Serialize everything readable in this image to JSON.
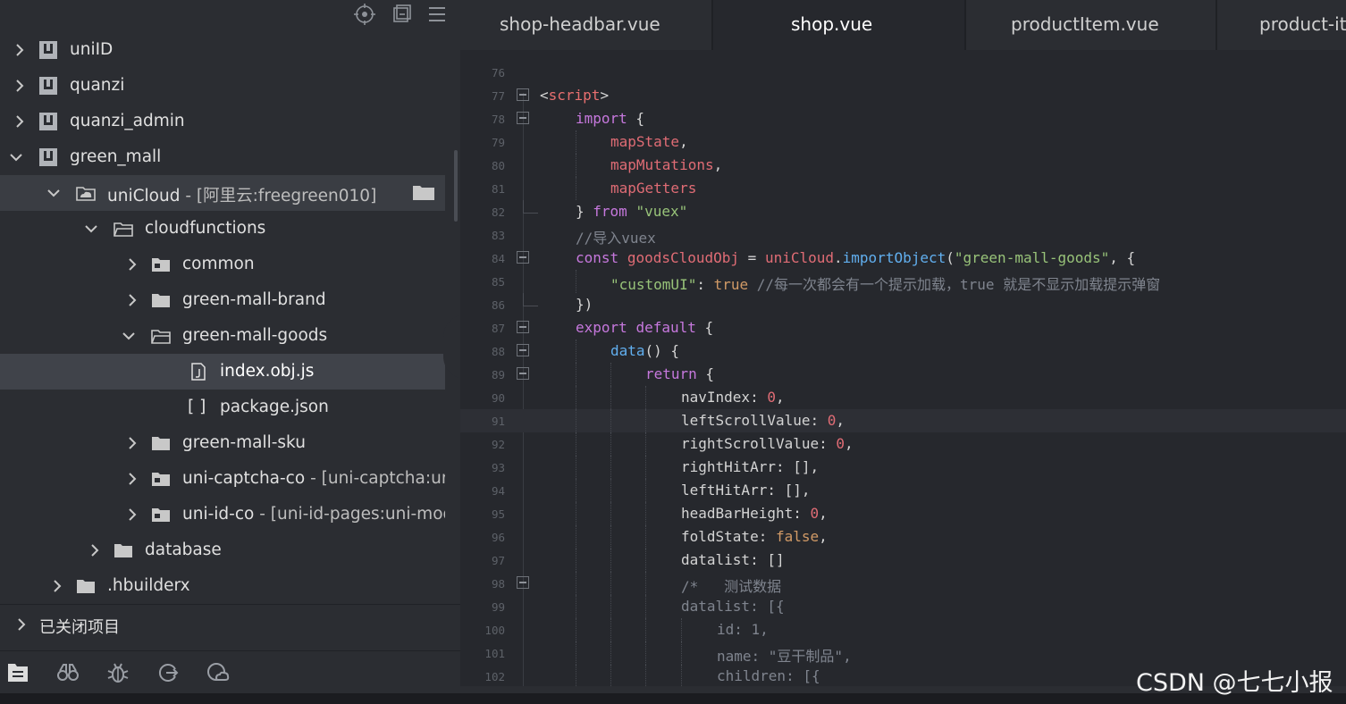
{
  "sidebar": {
    "top_icons": [
      "target-icon",
      "collapse-all-icon",
      "menu-icon"
    ],
    "tree": [
      {
        "label": "uniID",
        "suffix": ""
      },
      {
        "label": "quanzi",
        "suffix": ""
      },
      {
        "label": "quanzi_admin",
        "suffix": ""
      },
      {
        "label": "green_mall",
        "suffix": ""
      },
      {
        "label": "uniCloud",
        "suffix": "[阿里云:freegreen010]"
      },
      {
        "label": "cloudfunctions",
        "suffix": ""
      },
      {
        "label": "common",
        "suffix": ""
      },
      {
        "label": "green-mall-brand",
        "suffix": ""
      },
      {
        "label": "green-mall-goods",
        "suffix": ""
      },
      {
        "label": "index.obj.js",
        "suffix": ""
      },
      {
        "label": "package.json",
        "suffix": ""
      },
      {
        "label": "green-mall-sku",
        "suffix": ""
      },
      {
        "label": "uni-captcha-co",
        "suffix": "[uni-captcha:uni-"
      },
      {
        "label": "uni-id-co",
        "suffix": "[uni-id-pages:uni-mod"
      },
      {
        "label": "database",
        "suffix": ""
      },
      {
        "label": ".hbuilderx",
        "suffix": ""
      }
    ],
    "separator": "-",
    "json_brackets": "[ ]",
    "closed_projects_label": "已关闭项目",
    "bottom_icons": [
      "project-explorer-icon",
      "binoculars-icon",
      "bug-icon",
      "deploy-icon",
      "cloud-icon"
    ]
  },
  "tabs": [
    {
      "label": "shop-headbar.vue",
      "active": false
    },
    {
      "label": "shop.vue",
      "active": true
    },
    {
      "label": "productItem.vue",
      "active": false
    },
    {
      "label": "product-it",
      "active": false
    }
  ],
  "editor": {
    "line_numbers": [
      "76",
      "77",
      "78",
      "79",
      "80",
      "81",
      "82",
      "83",
      "84",
      "85",
      "86",
      "87",
      "88",
      "89",
      "90",
      "91",
      "92",
      "93",
      "94",
      "95",
      "96",
      "97",
      "98",
      "99",
      "100",
      "101",
      "102"
    ],
    "lines": {
      "l77": {
        "open": "<",
        "tag": "script",
        "close": ">"
      },
      "l78": {
        "kw": "import",
        "rest": " {"
      },
      "l79": {
        "var": "mapState",
        "rest": ","
      },
      "l80": {
        "var": "mapMutations",
        "rest": ","
      },
      "l81": {
        "var": "mapGetters"
      },
      "l82": {
        "pre": "} ",
        "kw": "from",
        "str": "\"vuex\""
      },
      "l83": {
        "comment": "//导入vuex"
      },
      "l84": {
        "kw": "const",
        "var": "goodsCloudObj",
        "eq": " = ",
        "obj": "uniCloud",
        "dot": ".",
        "fn": "importObject",
        "open": "(",
        "str": "\"green-mall-goods\"",
        "rest": ", {"
      },
      "l85": {
        "key": "\"customUI\"",
        "colon": ": ",
        "bool": "true",
        "comment": " //每一次都会有一个提示加载，true 就是不显示加载提示弹窗"
      },
      "l86": {
        "text": "})"
      },
      "l87": {
        "kw": "export",
        "kw2": "default",
        "rest": " {"
      },
      "l88": {
        "fn": "data",
        "rest": "() {"
      },
      "l89": {
        "kw": "return",
        "rest": " {"
      },
      "l90": {
        "prop": "navIndex",
        "colon": ": ",
        "num": "0",
        "rest": ","
      },
      "l91": {
        "prop": "leftScrollValue",
        "colon": ": ",
        "num": "0",
        "rest": ","
      },
      "l92": {
        "prop": "rightScrollValue",
        "colon": ": ",
        "num": "0",
        "rest": ","
      },
      "l93": {
        "prop": "rightHitArr",
        "colon": ": ",
        "rest": "[],"
      },
      "l94": {
        "prop": "leftHitArr",
        "colon": ": ",
        "rest": "[],"
      },
      "l95": {
        "prop": "headBarHeight",
        "colon": ": ",
        "num": "0",
        "rest": ","
      },
      "l96": {
        "prop": "foldState",
        "colon": ": ",
        "bool": "false",
        "rest": ","
      },
      "l97": {
        "prop": "datalist",
        "colon": ": ",
        "rest": "[]"
      },
      "l98": {
        "comment": "/*   测试数据"
      },
      "l99": {
        "text": "datalist: [{"
      },
      "l100": {
        "text": "id: 1,"
      },
      "l101": {
        "text": "name: \"豆干制品\","
      },
      "l102": {
        "text": "children: [{"
      }
    }
  },
  "watermark": "CSDN @七七小报"
}
